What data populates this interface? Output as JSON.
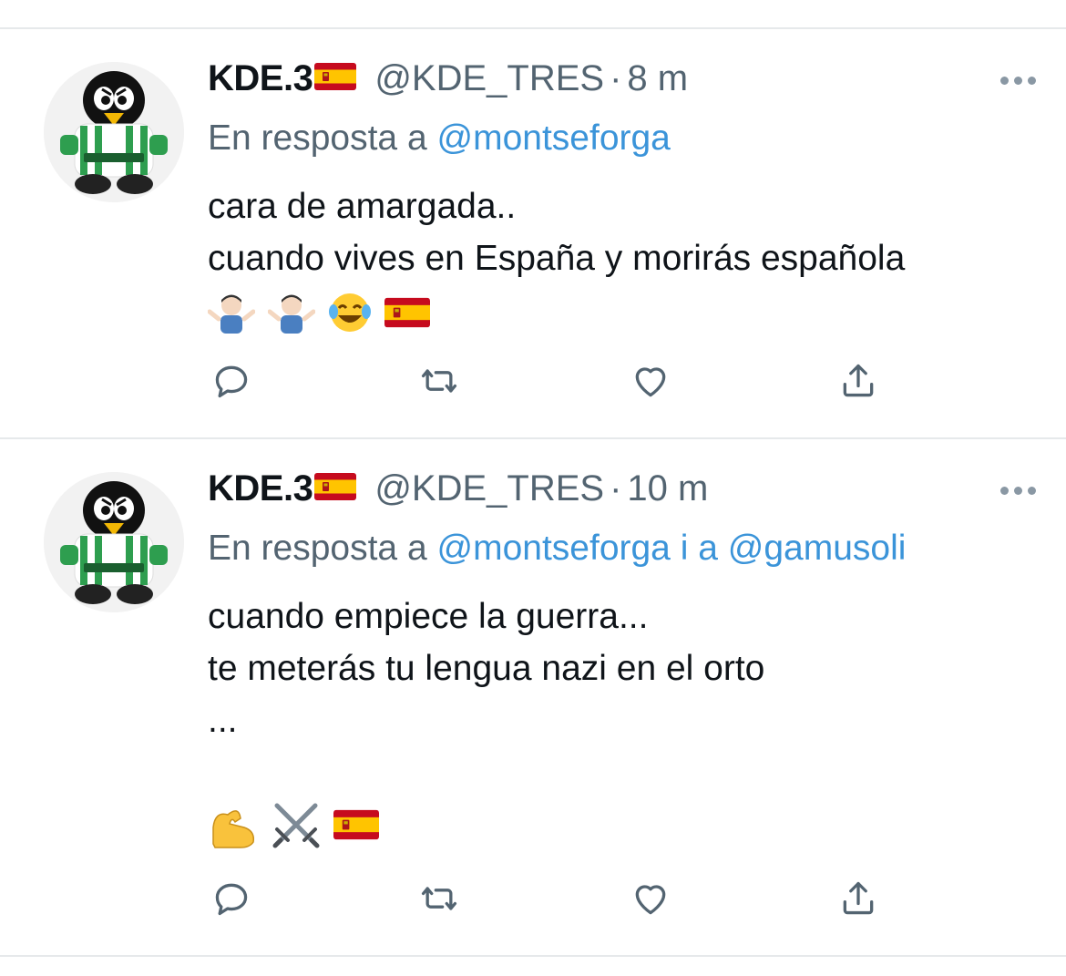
{
  "tweets": [
    {
      "display_name": "KDE.3",
      "handle": "@KDE_TRES",
      "separator": "·",
      "time": "8 m",
      "reply_prefix": "En resposta a",
      "reply_mentions": "@montseforga",
      "lines": [
        "cara de amargada..",
        "cuando vives en España y morirás española"
      ],
      "emoji_icons": [
        "person-shrugging-icon",
        "person-shrugging-icon",
        "face-with-tears-of-joy-icon",
        "spain-flag-icon"
      ]
    },
    {
      "display_name": "KDE.3",
      "handle": "@KDE_TRES",
      "separator": "·",
      "time": "10 m",
      "reply_prefix": "En resposta a",
      "reply_mentions": "@montseforga i a @gamusoli",
      "lines": [
        "cuando empiece la guerra...",
        "te meterás tu lengua nazi en el orto",
        "..."
      ],
      "emoji_icons": [
        "flexed-biceps-icon",
        "crossed-swords-icon",
        "spain-flag-icon"
      ]
    }
  ],
  "actions": [
    "reply-icon",
    "retweet-icon",
    "like-icon",
    "share-icon"
  ],
  "colors": {
    "text": "#0f1419",
    "secondary": "#536471",
    "mention": "#3b94d9",
    "divider": "#e6e9eb",
    "avatar_jersey_green": "#2e9e4f"
  }
}
